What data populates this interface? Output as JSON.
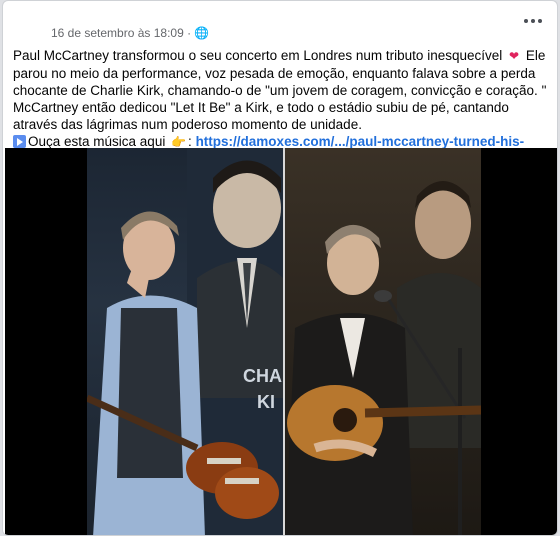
{
  "post": {
    "timestamp": "16 de setembro às 18:09 · 🌐",
    "text_line1": "Paul McCartney transformou o seu concerto em Londres num tributo inesquecível",
    "text_line2": "Ele parou no meio da performance, voz pesada de emoção, enquanto falava sobre a perda chocante de Charlie Kirk, chamando-o de \"um jovem de coragem, convicção e coração. \" McCartney então dedicou \"Let It Be\" a Kirk, e todo o estádio subiu de pé, cantando através das lágrimas num poderoso momento de unidade.",
    "cta_text": "Ouça esta música aqui",
    "link_text": "https://damoxes.com/.../paul-mccartney-turned-his-london..."
  },
  "image": {
    "left_poster_text_1": "CHA",
    "left_poster_text_2": "KI"
  },
  "icons": {
    "heart": "broken-heart-icon",
    "play": "play-button-icon",
    "hand": "pointing-hand-icon",
    "more": "more-options-icon"
  },
  "colors": {
    "link": "#216fdb",
    "heart": "#e0245e",
    "play_bg": "#5b8def"
  }
}
